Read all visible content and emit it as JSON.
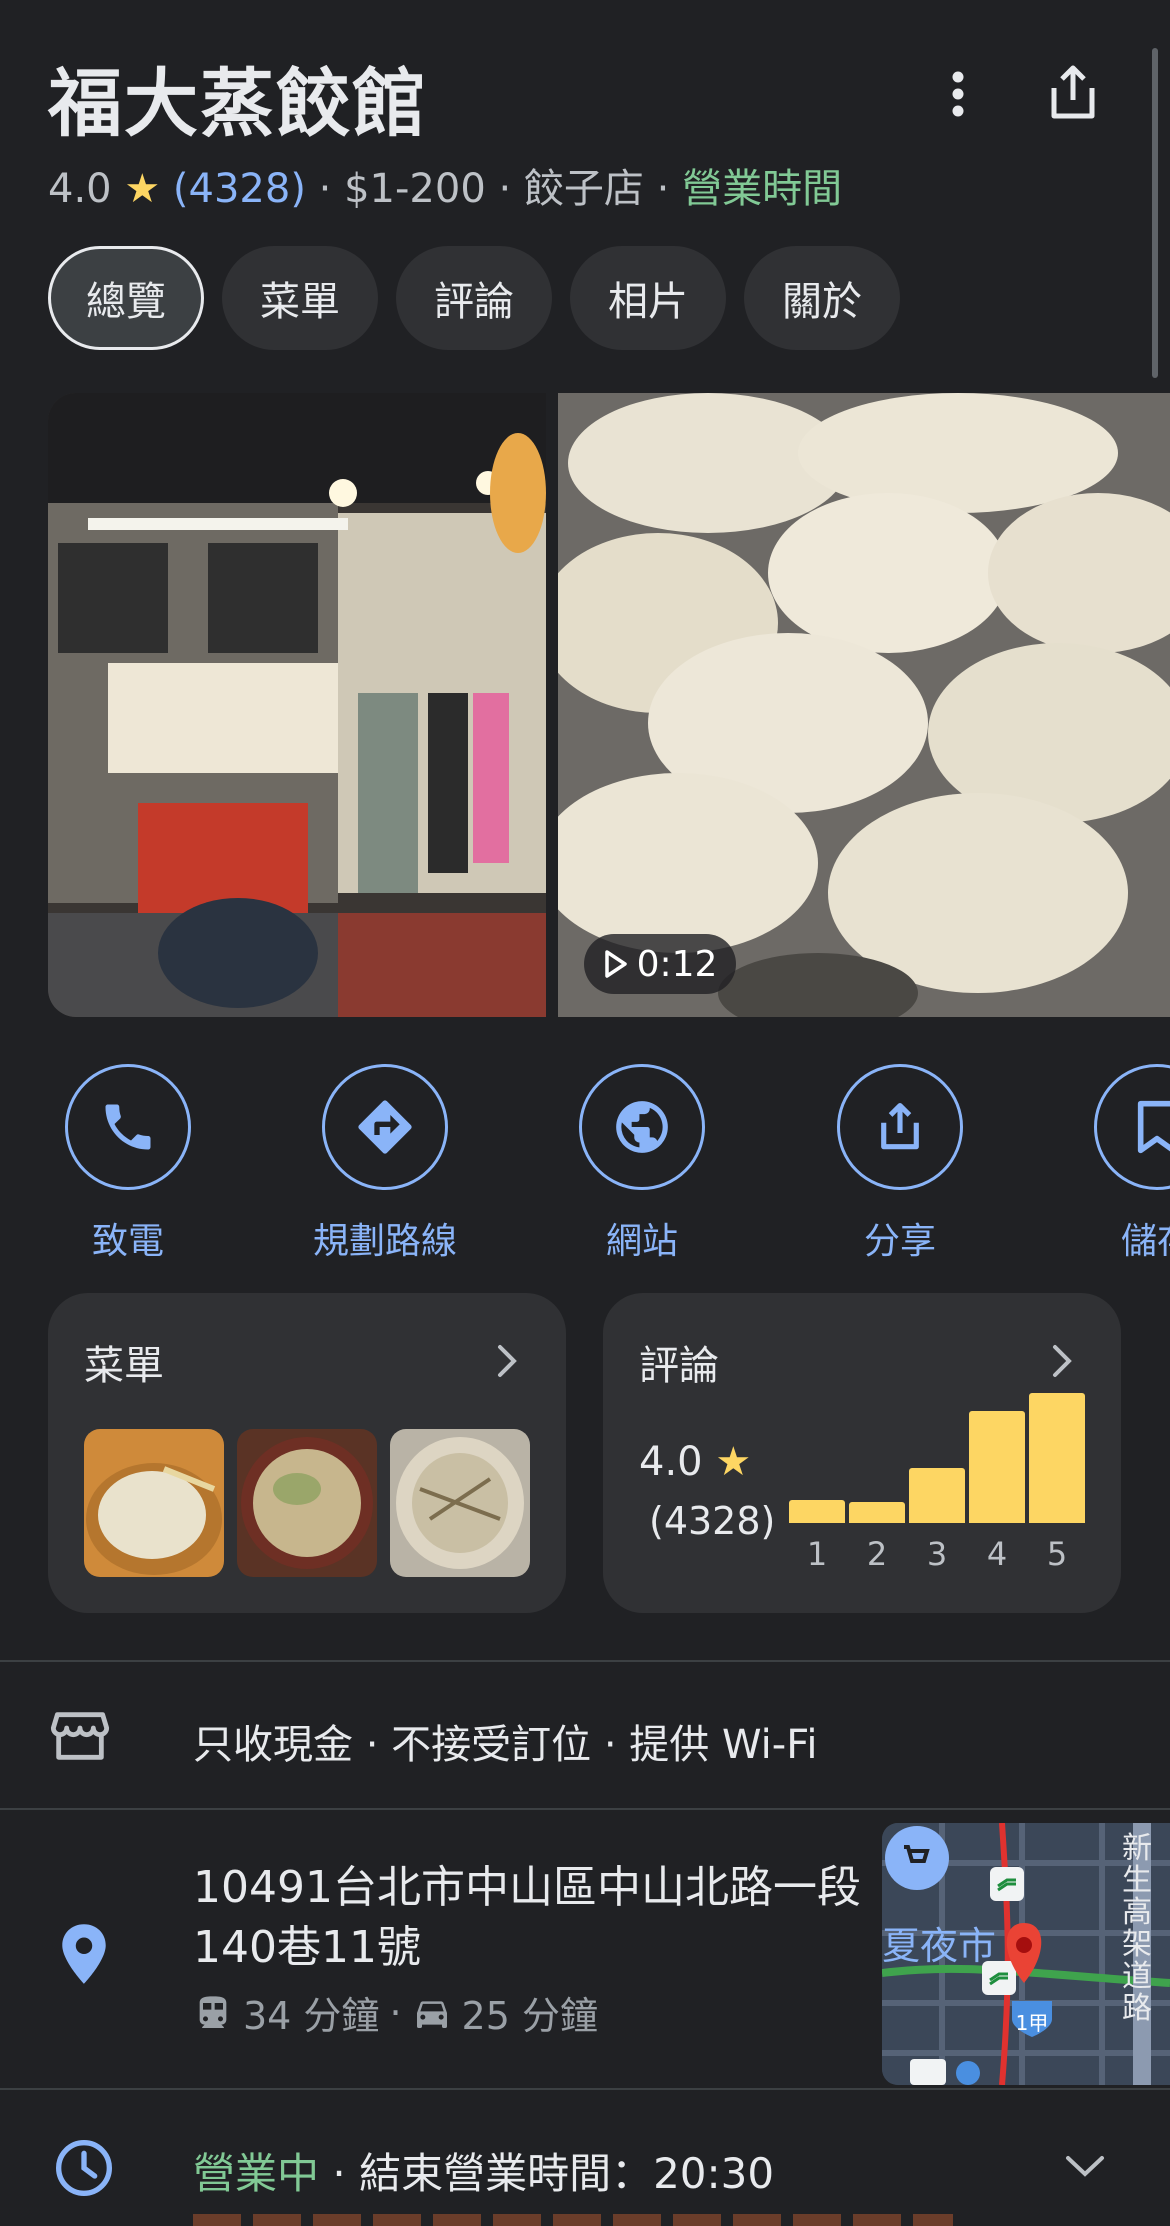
{
  "place": {
    "name": "福大蒸餃館",
    "rating": "4.0",
    "star": "★",
    "review_count": "(4328)",
    "sep": "·",
    "price": "$1-200",
    "category": "餃子店",
    "hours_link": "營業時間"
  },
  "tabs": [
    {
      "label": "總覽",
      "active": true
    },
    {
      "label": "菜單"
    },
    {
      "label": "評論"
    },
    {
      "label": "相片"
    },
    {
      "label": "關於"
    }
  ],
  "photos": {
    "video_duration": "0:12"
  },
  "actions": [
    {
      "label": "致電",
      "icon": "phone-icon"
    },
    {
      "label": "規劃路線",
      "icon": "directions-icon"
    },
    {
      "label": "網站",
      "icon": "globe-icon"
    },
    {
      "label": "分享",
      "icon": "share-icon"
    },
    {
      "label": "儲存",
      "icon": "bookmark-icon"
    }
  ],
  "menu_card": {
    "title": "菜單"
  },
  "review_card": {
    "title": "評論",
    "rating": "4.0",
    "count": "(4328)",
    "distribution": [
      {
        "stars": "1",
        "fraction": 0.18
      },
      {
        "stars": "2",
        "fraction": 0.16
      },
      {
        "stars": "3",
        "fraction": 0.42
      },
      {
        "stars": "4",
        "fraction": 0.86
      },
      {
        "stars": "5",
        "fraction": 1.0
      }
    ]
  },
  "attributes": {
    "text": "只收現金 · 不接受訂位 · 提供 Wi-Fi"
  },
  "address": {
    "text": "10491台北市中山區中山北路一段140巷11號",
    "transit_time": "34 分鐘",
    "sep": "·",
    "drive_time": "25 分鐘"
  },
  "map": {
    "label_market": "夏夜市",
    "label_road": "新生高架道路",
    "label_shield": "1甲"
  },
  "hours": {
    "status": "營業中",
    "sep": " · ",
    "closing": "結束營業時間：20:30"
  },
  "colors": {
    "background": "#202124",
    "accent_blue": "#8ab4f8",
    "open_green": "#81c995",
    "star_yellow": "#fdd663"
  }
}
